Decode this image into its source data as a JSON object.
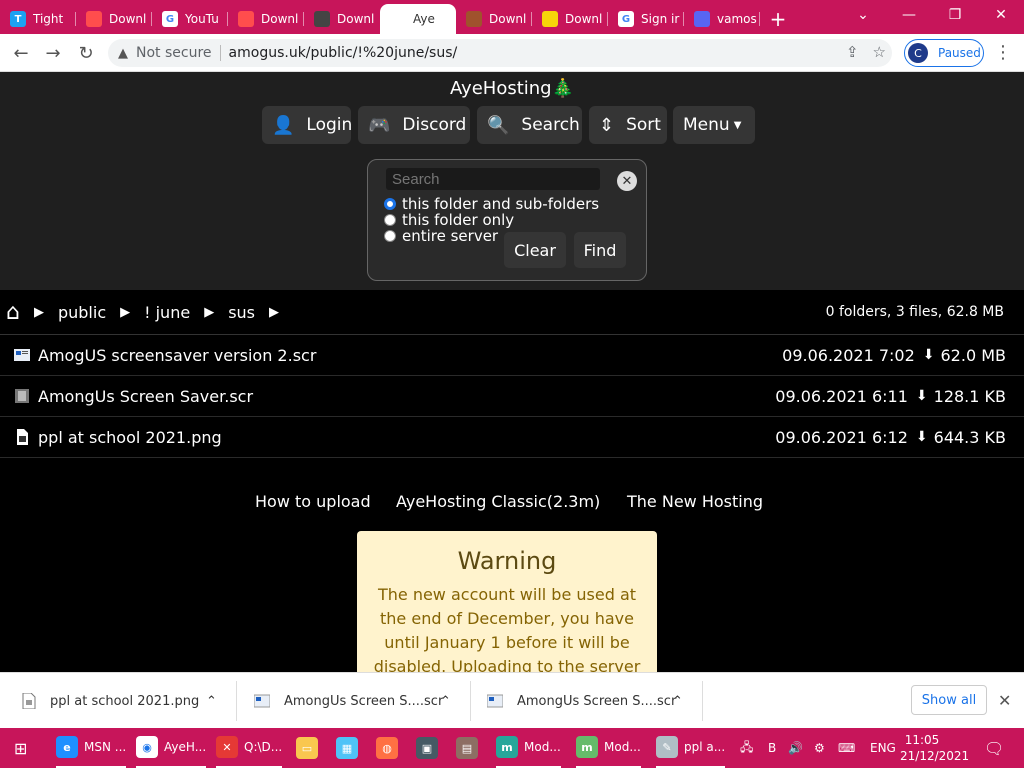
{
  "browser": {
    "tabs": [
      {
        "title": "Tight",
        "fav": "T",
        "color": "#1da1f2"
      },
      {
        "title": "Downl",
        "fav": "",
        "color": "#ff4d4d"
      },
      {
        "title": "YouTu",
        "fav": "G",
        "color": "#ffffff"
      },
      {
        "title": "Downl",
        "fav": "",
        "color": "#ff4d4d"
      },
      {
        "title": "Downl",
        "fav": "",
        "color": "#444444"
      },
      {
        "title": "Aye",
        "fav": "",
        "color": "#ffffff"
      },
      {
        "title": "Downl",
        "fav": "",
        "color": "#a0522d"
      },
      {
        "title": "Downl",
        "fav": "",
        "color": "#f7d40a"
      },
      {
        "title": "Sign ir",
        "fav": "G",
        "color": "#ffffff"
      },
      {
        "title": "vamos",
        "fav": "",
        "color": "#5865f2"
      }
    ],
    "new_tab": "+",
    "security": "Not secure",
    "url": "amogus.uk/public/!%20june/sus/",
    "profile_initial": "C",
    "profile_status": "Paused"
  },
  "page": {
    "site_title": "AyeHosting🎄",
    "buttons": {
      "login": "Login",
      "discord": "Discord",
      "search": "Search",
      "sort": "Sort",
      "menu": "Menu"
    },
    "search": {
      "placeholder": "Search",
      "options": [
        "this folder and sub-folders",
        "this folder only",
        "entire server"
      ],
      "selected": 0,
      "clear": "Clear",
      "find": "Find"
    },
    "breadcrumb": [
      "public",
      "! june",
      "sus"
    ],
    "summary": "0 folders, 3 files, 62.8 MB",
    "files": [
      {
        "name": "AmogUS screensaver version 2.scr",
        "date": "09.06.2021 7:02",
        "size": "62.0 MB"
      },
      {
        "name": "AmongUs Screen Saver.scr",
        "date": "09.06.2021 6:11",
        "size": "128.1 KB"
      },
      {
        "name": "ppl at school 2021.png",
        "date": "09.06.2021 6:12",
        "size": "644.3 KB"
      }
    ],
    "footer_links": [
      "How to upload",
      "AyeHosting Classic(2.3m)",
      "The New Hosting"
    ],
    "warning": {
      "title": "Warning",
      "text": "The new account will be used at the end of December, you have until January 1 before it will be disabled. Uploading to the server"
    }
  },
  "downloads": {
    "items": [
      "ppl at school 2021.png",
      "AmongUs Screen S....scr",
      "AmongUs Screen S....scr"
    ],
    "show_all": "Show all"
  },
  "taskbar": {
    "apps": [
      {
        "label": "MSN ...",
        "color": "#1e90ff",
        "glyph": "e"
      },
      {
        "label": "AyeH...",
        "color": "#ffffff",
        "glyph": "◉"
      },
      {
        "label": "Q:\\D...",
        "color": "#e53935",
        "glyph": "✕"
      },
      {
        "label": "",
        "color": "#f9c74f",
        "glyph": "▭"
      },
      {
        "label": "",
        "color": "#4fc3f7",
        "glyph": "▦"
      },
      {
        "label": "",
        "color": "#ff7043",
        "glyph": "◍"
      },
      {
        "label": "",
        "color": "#455a64",
        "glyph": "▣"
      },
      {
        "label": "",
        "color": "#8d6e63",
        "glyph": "▤"
      },
      {
        "label": "Mod...",
        "color": "#26a69a",
        "glyph": "m"
      },
      {
        "label": "Mod...",
        "color": "#66bb6a",
        "glyph": "m"
      },
      {
        "label": "ppl a...",
        "color": "#b0bec5",
        "glyph": "✎"
      }
    ],
    "lang": "ENG",
    "time": "11:05",
    "date": "21/12/2021"
  }
}
